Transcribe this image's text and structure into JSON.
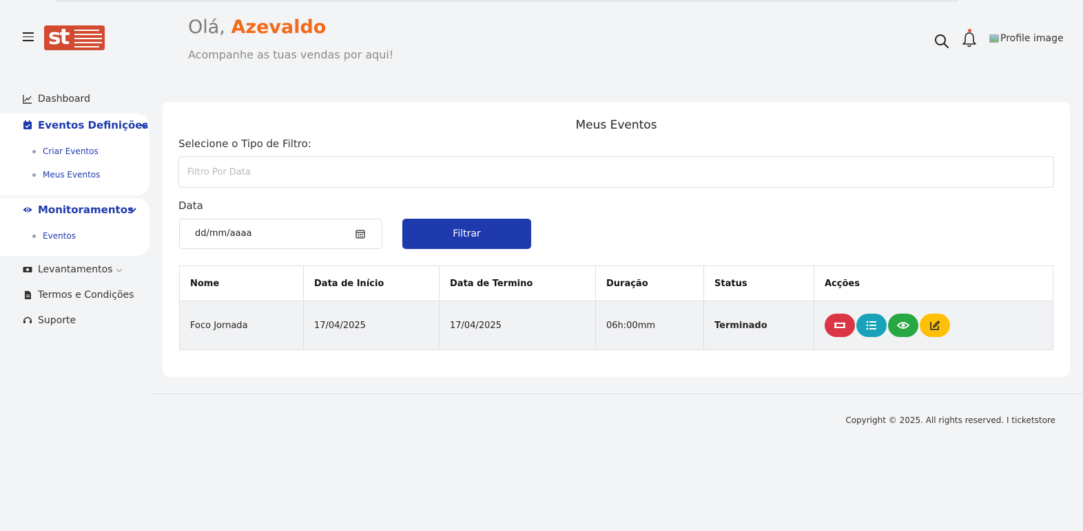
{
  "header": {
    "greeting_prefix": "Olá,",
    "user_name": "Azevaldo",
    "subtitle": "Acompanhe as tuas vendas por aqui!",
    "profile_alt": "Profile image",
    "logo_text": "st"
  },
  "sidebar": {
    "dashboard": "Dashboard",
    "eventos_definicoes": {
      "label": "Eventos Definições",
      "items": [
        "Criar Eventos",
        "Meus Eventos"
      ]
    },
    "monitoramentos": {
      "label": "Monitoramentos",
      "items": [
        "Eventos"
      ]
    },
    "levantamentos": "Levantamentos",
    "termos": "Termos e Condições",
    "suporte": "Suporte"
  },
  "main": {
    "title": "Meus Eventos",
    "filter_label": "Selecione o Tipo de Filtro:",
    "filter_placeholder": "Filtro Por Data",
    "date_label": "Data",
    "date_placeholder": "dd/mm/aaaa",
    "filter_button": "Filtrar",
    "table": {
      "headers": [
        "Nome",
        "Data de Início",
        "Data de Termino",
        "Duração",
        "Status",
        "Acções"
      ],
      "rows": [
        {
          "nome": "Foco Jornada",
          "inicio": "17/04/2025",
          "termino": "17/04/2025",
          "duracao": "06h:00mm",
          "status": "Terminado",
          "actions": [
            "ticket-icon",
            "list-icon",
            "eye-icon",
            "edit-icon"
          ]
        }
      ]
    }
  },
  "footer": {
    "copyright": "Copyright © 2025. All rights reserved. I ticketstore"
  },
  "colors": {
    "primary": "#1e3aad",
    "accent": "#f26a1b",
    "logo": "#d24a30",
    "status_done": "#3aa655",
    "btn_red": "#dc3545",
    "btn_cyan": "#17a2b8",
    "btn_green": "#28a745",
    "btn_yellow": "#ffc107"
  }
}
